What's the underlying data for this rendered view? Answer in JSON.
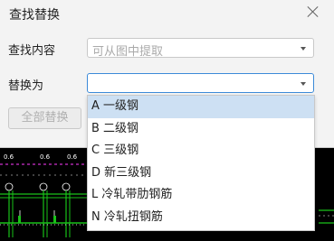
{
  "dialog": {
    "title": "查找替换",
    "find_label": "查找内容",
    "find_placeholder": "可从图中提取",
    "replace_label": "替换为",
    "replace_value": "",
    "replace_all_label": "全部替换"
  },
  "dropdown": {
    "options": [
      {
        "label": "A 一级钢",
        "selected": true
      },
      {
        "label": "B 二级钢",
        "selected": false
      },
      {
        "label": "C 三级钢",
        "selected": false
      },
      {
        "label": "D 新三级钢",
        "selected": false
      },
      {
        "label": "L 冷轧带肋钢筋",
        "selected": false
      },
      {
        "label": "N 冷轧扭钢筋",
        "selected": false
      }
    ]
  },
  "cad": {
    "grid_labels": [
      "①",
      "②",
      "③"
    ],
    "colors": {
      "line_green": "#19c219",
      "line_white": "#ffffff",
      "line_magenta": "#ff3bff"
    }
  }
}
